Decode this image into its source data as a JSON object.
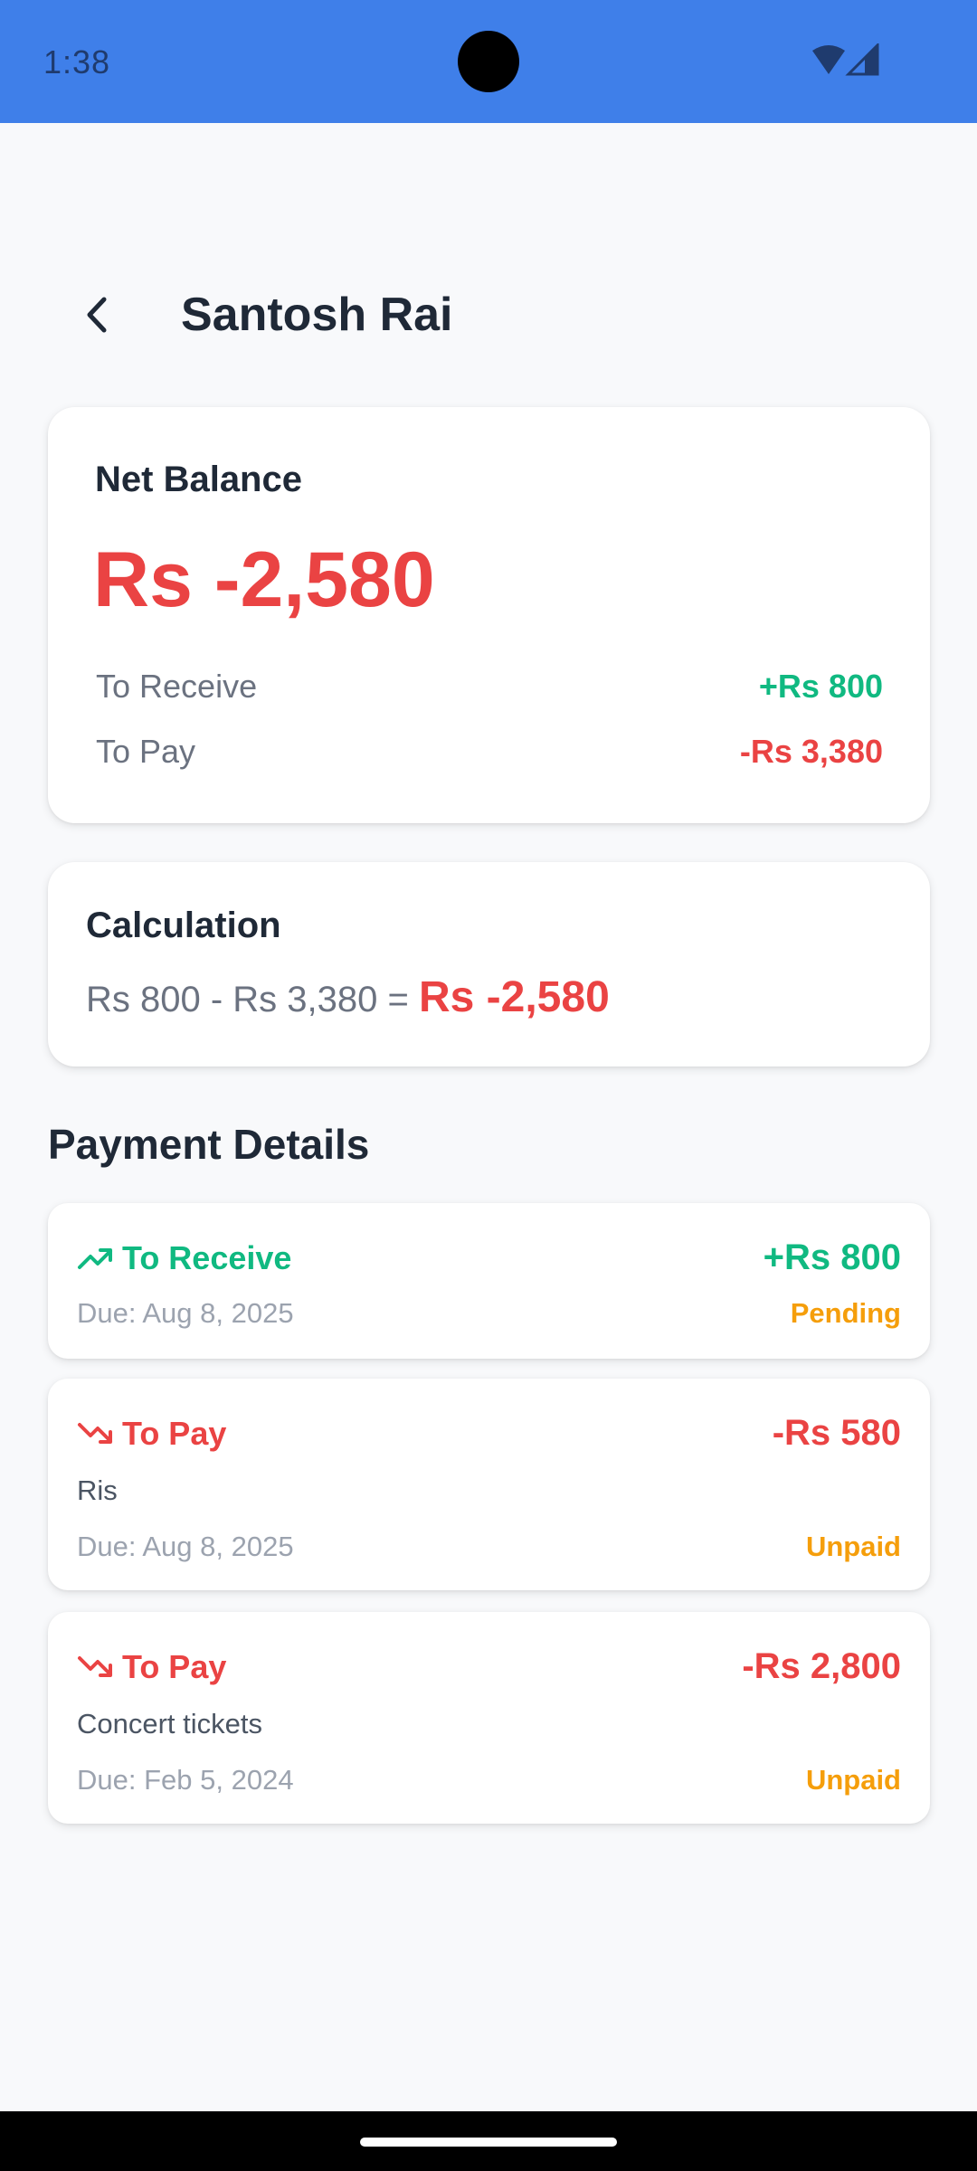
{
  "status_bar": {
    "time": "1:38",
    "icons": [
      "wifi-icon",
      "signal-icon"
    ],
    "background": "#3f7fe9"
  },
  "header": {
    "title": "Santosh Rai",
    "back_icon": "chevron-left-icon"
  },
  "balance": {
    "label": "Net Balance",
    "amount": "Rs -2,580",
    "to_receive_label": "To Receive",
    "to_receive_value": "+Rs 800",
    "to_pay_label": "To Pay",
    "to_pay_value": "-Rs 3,380"
  },
  "calculation": {
    "label": "Calculation",
    "expression": "Rs 800 - Rs 3,380 = ",
    "result": "Rs -2,580"
  },
  "payment_details": {
    "title": "Payment Details",
    "items": [
      {
        "type": "To Receive",
        "icon": "trending-up-icon",
        "amount": "+Rs 800",
        "description": "",
        "due": "Due: Aug 8, 2025",
        "status": "Pending"
      },
      {
        "type": "To Pay",
        "icon": "trending-down-icon",
        "amount": "-Rs 580",
        "description": "Ris",
        "due": "Due: Aug 8, 2025",
        "status": "Unpaid"
      },
      {
        "type": "To Pay",
        "icon": "trending-down-icon",
        "amount": "-Rs 2,800",
        "description": "Concert tickets",
        "due": "Due: Feb 5, 2024",
        "status": "Unpaid"
      }
    ]
  },
  "colors": {
    "positive": "#10b981",
    "negative": "#ea4343",
    "status": "#f59e0b",
    "text": "#1f2937",
    "muted": "#6b7280"
  }
}
